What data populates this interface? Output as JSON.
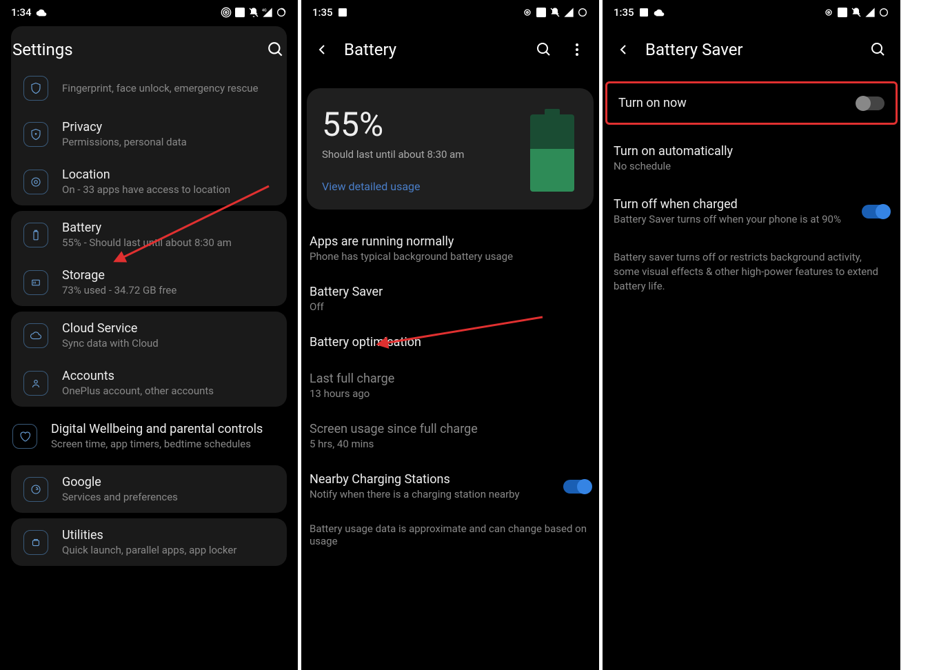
{
  "status": {
    "time1": "1:34",
    "time2": "1:35",
    "time3": "1:35"
  },
  "phone1": {
    "header": "Settings",
    "items": {
      "top_partial_sub": "Fingerprint, face unlock, emergency rescue",
      "privacy_title": "Privacy",
      "privacy_sub": "Permissions, personal data",
      "location_title": "Location",
      "location_sub": "On - 33 apps have access to location",
      "battery_title": "Battery",
      "battery_sub": "55% - Should last until about 8:30 am",
      "storage_title": "Storage",
      "storage_sub": "73% used - 34.72 GB free",
      "cloud_title": "Cloud Service",
      "cloud_sub": "Sync data with Cloud",
      "accounts_title": "Accounts",
      "accounts_sub": "OnePlus account, other accounts",
      "dw_title": "Digital Wellbeing and parental controls",
      "dw_sub": "Screen time, app timers, bedtime schedules",
      "google_title": "Google",
      "google_sub": "Services and preferences",
      "utilities_title": "Utilities",
      "utilities_sub": "Quick launch, parallel apps, app locker"
    }
  },
  "phone2": {
    "header": "Battery",
    "card": {
      "pct": "55%",
      "sub": "Should last until about 8:30 am",
      "link": "View detailed usage"
    },
    "rows": {
      "apps_title": "Apps are running normally",
      "apps_sub": "Phone has typical background battery usage",
      "saver_title": "Battery Saver",
      "saver_sub": "Off",
      "opt_title": "Battery optimisation",
      "last_title": "Last full charge",
      "last_sub": "13 hours ago",
      "screen_title": "Screen usage since full charge",
      "screen_sub": "5 hrs, 40 mins",
      "nearby_title": "Nearby Charging Stations",
      "nearby_sub": "Notify when there is a charging station nearby",
      "footer": "Battery usage data is approximate and can change based on usage"
    }
  },
  "phone3": {
    "header": "Battery Saver",
    "rows": {
      "turn_on_now": "Turn on now",
      "auto_title": "Turn on automatically",
      "auto_sub": "No schedule",
      "off_title": "Turn off when charged",
      "off_sub": "Battery Saver turns off when your phone is at 90%",
      "desc": "Battery saver turns off or restricts background activity, some visual effects & other high-power features to extend battery life."
    }
  }
}
